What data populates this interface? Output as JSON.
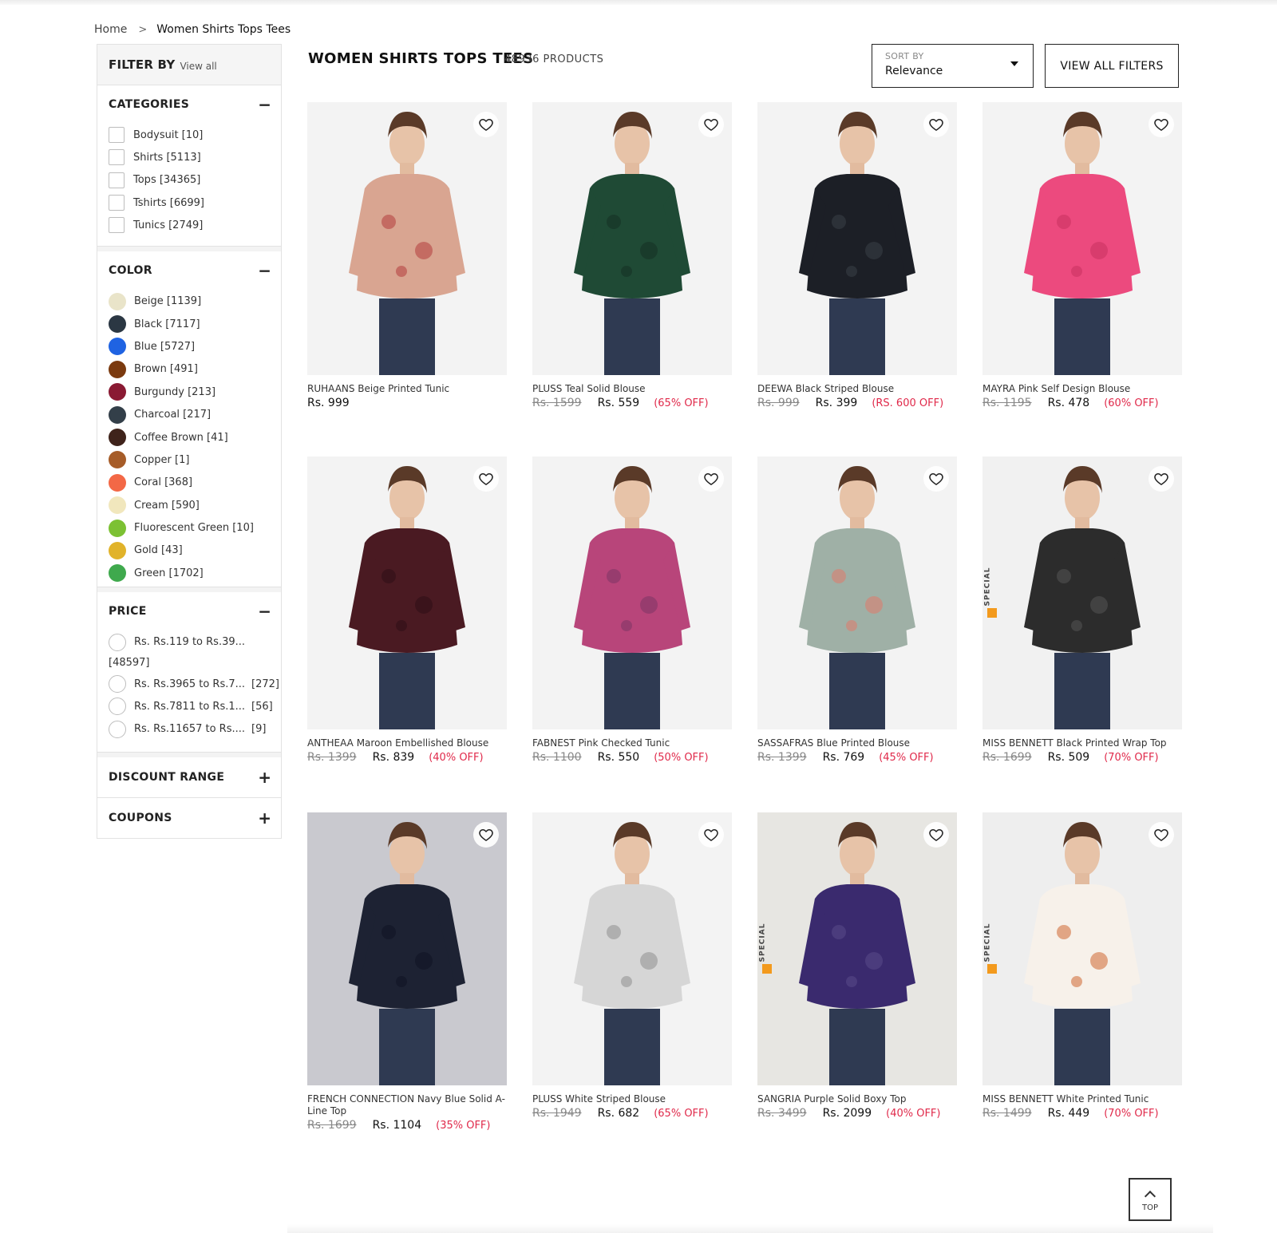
{
  "breadcrumb": {
    "home": "Home",
    "separator": ">",
    "current": "Women Shirts Tops Tees"
  },
  "sidebar": {
    "filter_by": "FILTER BY",
    "view_all": "View all",
    "categories": {
      "title": "CATEGORIES",
      "toggle": "−",
      "items": [
        "Bodysuit [10]",
        "Shirts [5113]",
        "Tops [34365]",
        "Tshirts [6699]",
        "Tunics [2749]"
      ]
    },
    "color": {
      "title": "COLOR",
      "toggle": "−",
      "items": [
        {
          "label": "Beige [1139]",
          "swatch": "#e9e4c9"
        },
        {
          "label": "Black [7117]",
          "swatch": "#2b3743"
        },
        {
          "label": "Blue [5727]",
          "swatch": "#1f63e2"
        },
        {
          "label": "Brown [491]",
          "swatch": "#7b3a0f"
        },
        {
          "label": "Burgundy [213]",
          "swatch": "#8a1a33"
        },
        {
          "label": "Charcoal [217]",
          "swatch": "#333f49"
        },
        {
          "label": "Coffee Brown [41]",
          "swatch": "#3f231b"
        },
        {
          "label": "Copper [1]",
          "swatch": "#a65c28"
        },
        {
          "label": "Coral [368]",
          "swatch": "#f36846"
        },
        {
          "label": "Cream [590]",
          "swatch": "#f1e7bd"
        },
        {
          "label": "Fluorescent Green [10]",
          "swatch": "#7cc133"
        },
        {
          "label": "Gold [43]",
          "swatch": "#e1b32a"
        },
        {
          "label": "Green [1702]",
          "swatch": "#3fa94d"
        }
      ]
    },
    "price": {
      "title": "PRICE",
      "toggle": "−",
      "first_label": "Rs. Rs.119 to Rs.39...",
      "first_count": "[48597]",
      "items": [
        {
          "label": "Rs. Rs.3965 to Rs.7...",
          "count": "[272]"
        },
        {
          "label": "Rs. Rs.7811 to Rs.1...",
          "count": "[56]"
        },
        {
          "label": "Rs. Rs.11657 to Rs....",
          "count": "[9]"
        }
      ]
    },
    "discount": {
      "title": "DISCOUNT RANGE",
      "toggle": "+"
    },
    "coupons": {
      "title": "COUPONS",
      "toggle": "+"
    }
  },
  "header": {
    "title": "WOMEN SHIRTS TOPS TEES",
    "count": "48936 PRODUCTS",
    "sort_label": "SORT BY",
    "sort_value": "Relevance",
    "filters_button": "VIEW ALL FILTERS"
  },
  "products": [
    {
      "name": "RUHAANS Beige Printed Tunic",
      "mrp": "",
      "price": "Rs. 999",
      "off": "",
      "special": false,
      "colors": [
        "#f3f3f3",
        "#d9a591",
        "#b23c3c"
      ]
    },
    {
      "name": "PLUSS Teal Solid Blouse",
      "mrp": "Rs. 1599",
      "price": "Rs. 559",
      "off": "(65% OFF)",
      "special": false,
      "colors": [
        "#f3f3f3",
        "#1f4a35",
        "#142f23"
      ]
    },
    {
      "name": "DEEWA Black Striped Blouse",
      "mrp": "Rs. 999",
      "price": "Rs. 399",
      "off": "(RS. 600 OFF)",
      "special": false,
      "colors": [
        "#f3f3f3",
        "#1c1f26",
        "#3a3f47"
      ]
    },
    {
      "name": "MAYRA Pink Self Design Blouse",
      "mrp": "Rs. 1195",
      "price": "Rs. 478",
      "off": "(60% OFF)",
      "special": false,
      "colors": [
        "#f3f3f3",
        "#ec4a7e",
        "#c8325f"
      ]
    },
    {
      "name": "ANTHEAA Maroon Embellished Blouse",
      "mrp": "Rs. 1399",
      "price": "Rs. 839",
      "off": "(40% OFF)",
      "special": false,
      "colors": [
        "#f3f3f3",
        "#4a1a22",
        "#2d0f15"
      ]
    },
    {
      "name": "FABNEST Pink Checked Tunic",
      "mrp": "Rs. 1100",
      "price": "Rs. 550",
      "off": "(50% OFF)",
      "special": false,
      "colors": [
        "#f3f3f3",
        "#b8457a",
        "#7c3565"
      ]
    },
    {
      "name": "SASSAFRAS Blue Printed Blouse",
      "mrp": "Rs. 1399",
      "price": "Rs. 769",
      "off": "(45% OFF)",
      "special": false,
      "colors": [
        "#f3f3f3",
        "#9fb0a6",
        "#e07a6a"
      ]
    },
    {
      "name": "MISS BENNETT Black Printed Wrap Top",
      "mrp": "Rs. 1699",
      "price": "Rs. 509",
      "off": "(70% OFF)",
      "special": true,
      "special_text": "SPECIAL",
      "colors": [
        "#f1f1f1",
        "#2c2c2c",
        "#555555"
      ]
    },
    {
      "name": "FRENCH CONNECTION Navy Blue Solid A-Line Top",
      "mrp": "Rs. 1699",
      "price": "Rs. 1104",
      "off": "(35% OFF)",
      "special": false,
      "colors": [
        "#c9c9cf",
        "#1d2233",
        "#0f1322"
      ]
    },
    {
      "name": "PLUSS White Striped Blouse",
      "mrp": "Rs. 1949",
      "price": "Rs. 682",
      "off": "(65% OFF)",
      "special": false,
      "colors": [
        "#f3f3f3",
        "#d6d6d6",
        "#8f8f8f"
      ]
    },
    {
      "name": "SANGRIA Purple Solid Boxy Top",
      "mrp": "Rs. 3499",
      "price": "Rs. 2099",
      "off": "(40% OFF)",
      "special": true,
      "special_text": "SPECIAL",
      "colors": [
        "#e7e6e2",
        "#3a2a6e",
        "#5a4a8a"
      ]
    },
    {
      "name": "MISS BENNETT White Printed Tunic",
      "mrp": "Rs. 1499",
      "price": "Rs. 449",
      "off": "(70% OFF)",
      "special": true,
      "special_text": "SPECIAL",
      "colors": [
        "#eeeeee",
        "#f7f1ea",
        "#d0662f"
      ]
    }
  ],
  "top_button": "TOP"
}
